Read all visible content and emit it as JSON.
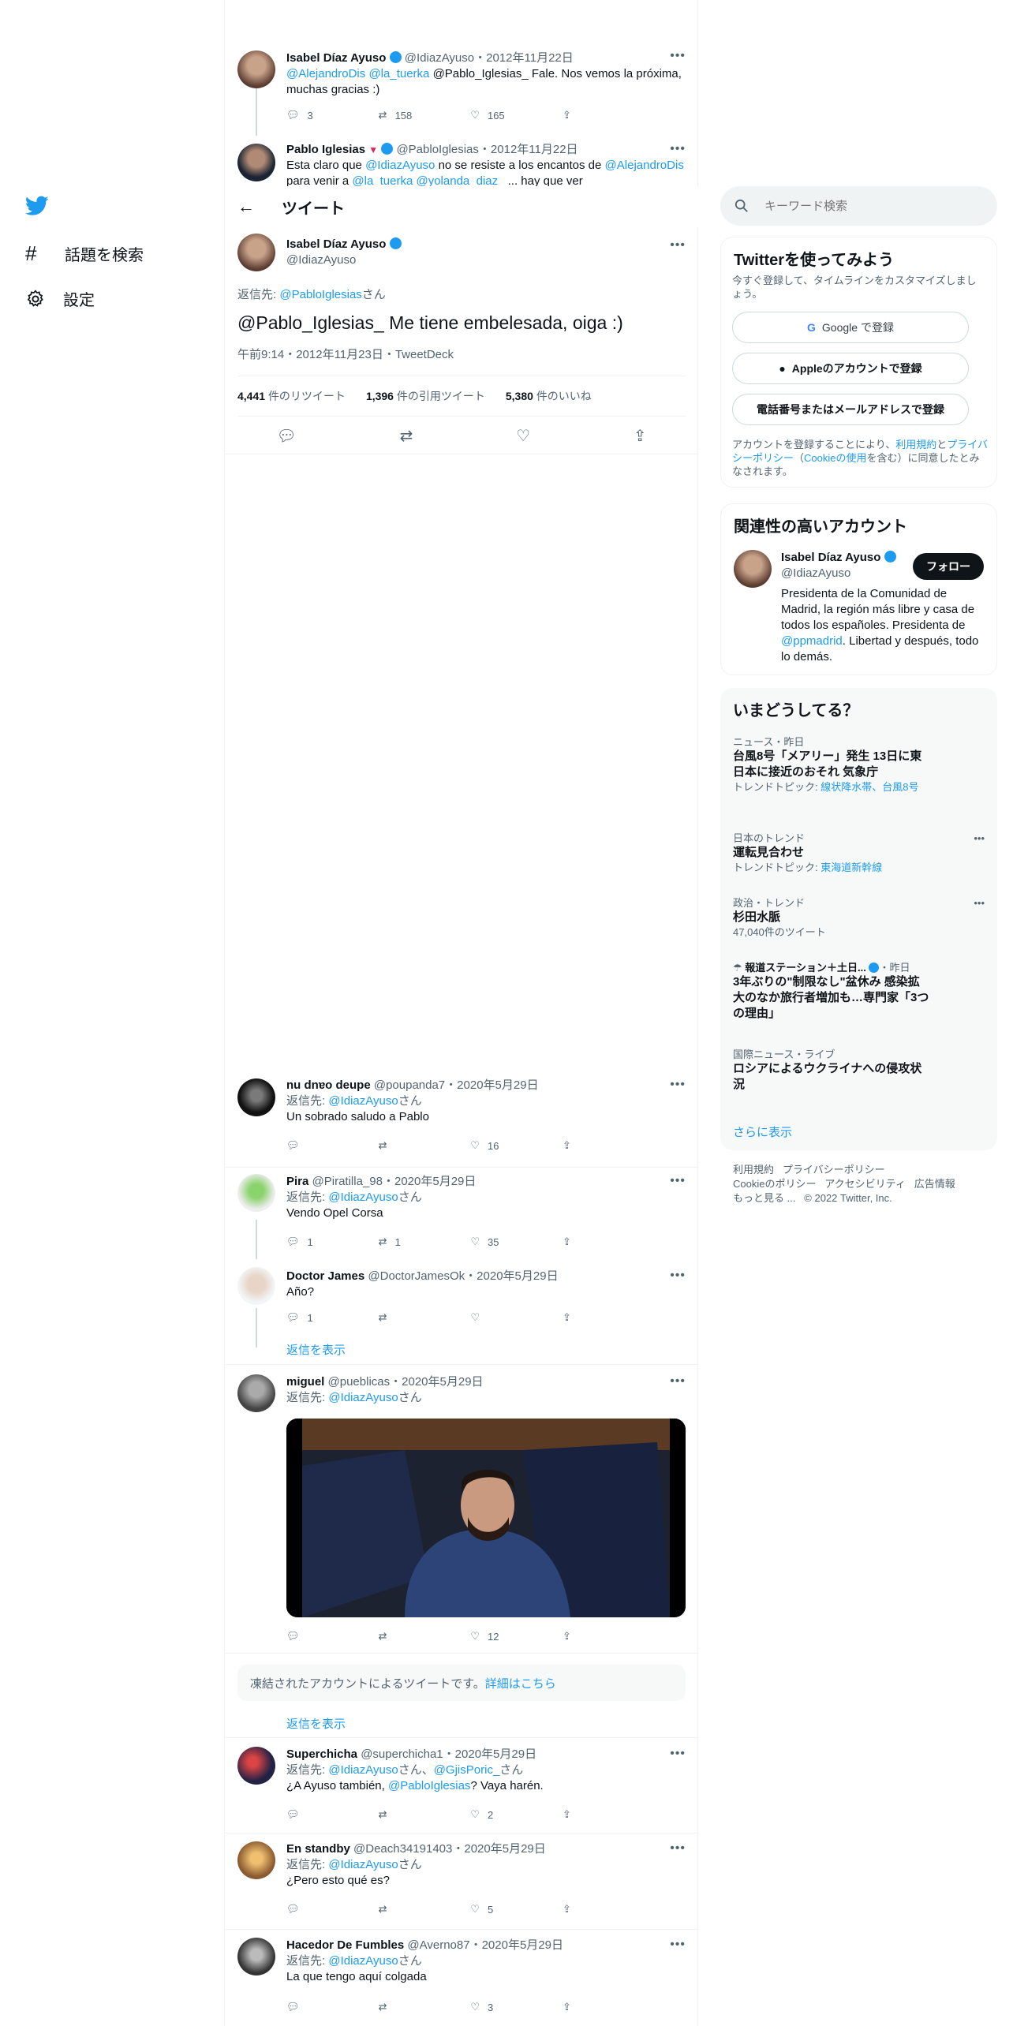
{
  "nav": {
    "explore": "話題を検索",
    "settings": "設定"
  },
  "header": {
    "title": "ツイート"
  },
  "top1": {
    "name": "Isabel Díaz Ayuso",
    "handle": "@IdiazAyuso",
    "date": "2012年11月22日",
    "m1": "@AlejandroDis",
    "m2": "@la_tuerka",
    "text1": "@Pablo_Iglesias_ Fale. Nos vemos la próxima,",
    "text2": "muchas gracias :)",
    "replies": "3",
    "rts": "158",
    "likes": "165"
  },
  "top2": {
    "name": "Pablo Iglesias",
    "handle": "@PabloIglesias",
    "date": "2012年11月22日",
    "t1": "Esta claro que",
    "m1": "@IdiazAyuso",
    "t2": "no se resiste a los encantos de",
    "m2": "@AlejandroDis",
    "t3": "para venir a",
    "m3": "@la_tuerka @yolanda_diaz_",
    "t4": "... hay que ver"
  },
  "main": {
    "name": "Isabel Díaz Ayuso",
    "handle": "@IdiazAyuso",
    "reply_label": "返信先:",
    "reply_to": "@PabloIglesias",
    "san": "さん",
    "text": "@Pablo_Iglesias_ Me tiene embelesada, oiga :)",
    "meta": "午前9:14・2012年11月23日・TweetDeck",
    "rt_n": "4,441",
    "rt_l": "件のリツイート",
    "q_n": "1,396",
    "q_l": "件の引用ツイート",
    "l_n": "5,380",
    "l_l": "件のいいね"
  },
  "replies": [
    {
      "name": "nu dnɐo deupe",
      "handle": "@poupanda7",
      "date": "2020年5月29日",
      "reply_label": "返信先:",
      "to": "@IdiazAyuso",
      "san": "さん",
      "text": "Un sobrado saludo a Pablo",
      "r": "",
      "rt": "",
      "l": "16"
    },
    {
      "name": "Pira",
      "handle": "@Piratilla_98",
      "date": "2020年5月29日",
      "reply_label": "返信先:",
      "to": "@IdiazAyuso",
      "san": "さん",
      "text": "Vendo Opel Corsa",
      "r": "1",
      "rt": "1",
      "l": "35"
    },
    {
      "name": "Doctor James",
      "handle": "@DoctorJamesOk",
      "date": "2020年5月29日",
      "text": "Año?",
      "r": "1",
      "rt": "",
      "l": ""
    },
    {
      "name": "miguel",
      "handle": "@pueblicas",
      "date": "2020年5月29日",
      "reply_label": "返信先:",
      "to": "@IdiazAyuso",
      "san": "さん",
      "r": "",
      "rt": "",
      "l": "12"
    },
    {
      "name": "Superchicha",
      "handle": "@superchicha1",
      "date": "2020年5月29日",
      "reply_label": "返信先:",
      "to": "@IdiazAyuso",
      "san": "さん、",
      "to2": "@GjisPoric_",
      "san2": "さん",
      "t1": "¿A Ayuso también,",
      "m": "@PabloIglesias",
      "t2": "? Vaya harén.",
      "r": "",
      "rt": "",
      "l": "2"
    },
    {
      "name": "En standby",
      "handle": "@Deach34191403",
      "date": "2020年5月29日",
      "reply_label": "返信先:",
      "to": "@IdiazAyuso",
      "san": "さん",
      "text": "¿Pero esto qué es?",
      "r": "",
      "rt": "",
      "l": "5"
    },
    {
      "name": "Hacedor De Fumbles",
      "handle": "@Averno87",
      "date": "2020年5月29日",
      "reply_label": "返信先:",
      "to": "@IdiazAyuso",
      "san": "さん",
      "text": "La que tengo aquí colgada",
      "r": "",
      "rt": "",
      "l": "3"
    }
  ],
  "show_replies": "返信を表示",
  "suspended": {
    "text": "凍結されたアカウントによるツイートです。",
    "link": "詳細はこちら"
  },
  "search": {
    "placeholder": "キーワード検索"
  },
  "signup": {
    "title": "Twitterを使ってみよう",
    "desc": "今すぐ登録して、タイムラインをカスタマイズしましょう。",
    "google": "Google で登録",
    "apple": "Appleのアカウントで登録",
    "phone": "電話番号またはメールアドレスで登録",
    "legal1": "アカウントを登録することにより、",
    "terms": "利用規約",
    "and": "と",
    "privacy": "プライバシーポリシー",
    "cookie_pre": "（",
    "cookie": "Cookieの使用",
    "legal2": "を含む）に同意したとみなされます。"
  },
  "related": {
    "title": "関連性の高いアカウント",
    "name": "Isabel Díaz Ayuso",
    "handle": "@IdiazAyuso",
    "follow": "フォロー",
    "bio1": "Presidenta de la Comunidad de Madrid, la región más libre y casa de todos los españoles. Presidenta de",
    "bio_link": "@ppmadrid",
    "bio2": ". Libertad y después, todo lo demás."
  },
  "trends": {
    "title": "いまどうしてる？",
    "items": [
      {
        "ctx": "ニュース・昨日",
        "title": "台風8号「メアリー」発生 13日に東日本に接近のおそれ 気象庁",
        "sub_l": "トレンドトピック:",
        "sub": "線状降水帯、台風8号"
      },
      {
        "ctx": "日本のトレンド",
        "title": "運転見合わせ",
        "sub_l": "トレンドトピック:",
        "sub": "東海道新幹線"
      },
      {
        "ctx": "政治・トレンド",
        "title": "杉田水脈",
        "sub_l": "47,040件のツイート",
        "sub": ""
      },
      {
        "ctx": "報道ステーション＋土日...",
        "ctx2": "・昨日",
        "title": "3年ぶりの\"制限なし\"盆休み 感染拡大のなか旅行者増加も…専門家「3つの理由」"
      },
      {
        "ctx": "国際ニュース・ライブ",
        "title": "ロシアによるウクライナへの侵攻状況"
      }
    ],
    "more": "さらに表示"
  },
  "footer": {
    "l1": [
      "利用規約",
      "プライバシーポリシー"
    ],
    "l2": [
      "Cookieのポリシー",
      "アクセシビリティ",
      "広告情報"
    ],
    "more": "もっと見る ...",
    "copy": "© 2022 Twitter, Inc."
  },
  "colors": {
    "accent": "#1d9bf0",
    "text": "#0f1419",
    "muted": "#536471"
  }
}
